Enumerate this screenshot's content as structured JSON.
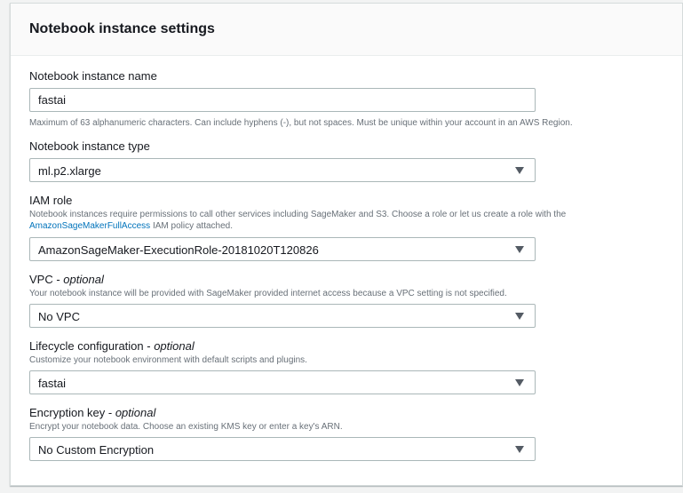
{
  "panel": {
    "title": "Notebook instance settings"
  },
  "fields": {
    "name": {
      "label": "Notebook instance name",
      "value": "fastai",
      "hint": "Maximum of 63 alphanumeric characters. Can include hyphens (-), but not spaces. Must be unique within your account in an AWS Region."
    },
    "type": {
      "label": "Notebook instance type",
      "value": "ml.p2.xlarge"
    },
    "iam": {
      "label": "IAM role",
      "hint_before": "Notebook instances require permissions to call other services including SageMaker and S3. Choose a role or let us create a role with the",
      "hint_link": "AmazonSageMakerFullAccess",
      "hint_after": " IAM policy attached.",
      "value": "AmazonSageMaker-ExecutionRole-20181020T120826"
    },
    "vpc": {
      "label": "VPC",
      "optional": "optional",
      "hint": "Your notebook instance will be provided with SageMaker provided internet access because a VPC setting is not specified.",
      "value": "No VPC"
    },
    "lifecycle": {
      "label": "Lifecycle configuration",
      "optional": "optional",
      "hint": "Customize your notebook environment with default scripts and plugins.",
      "value": "fastai"
    },
    "encryption": {
      "label": "Encryption key",
      "optional": "optional",
      "hint": "Encrypt your notebook data. Choose an existing KMS key or enter a key's ARN.",
      "value": "No Custom Encryption"
    }
  },
  "icons": {
    "dropdown": "caret-down-icon"
  },
  "colors": {
    "link": "#0073bb",
    "muted": "#687078",
    "border": "#aab7b8"
  }
}
